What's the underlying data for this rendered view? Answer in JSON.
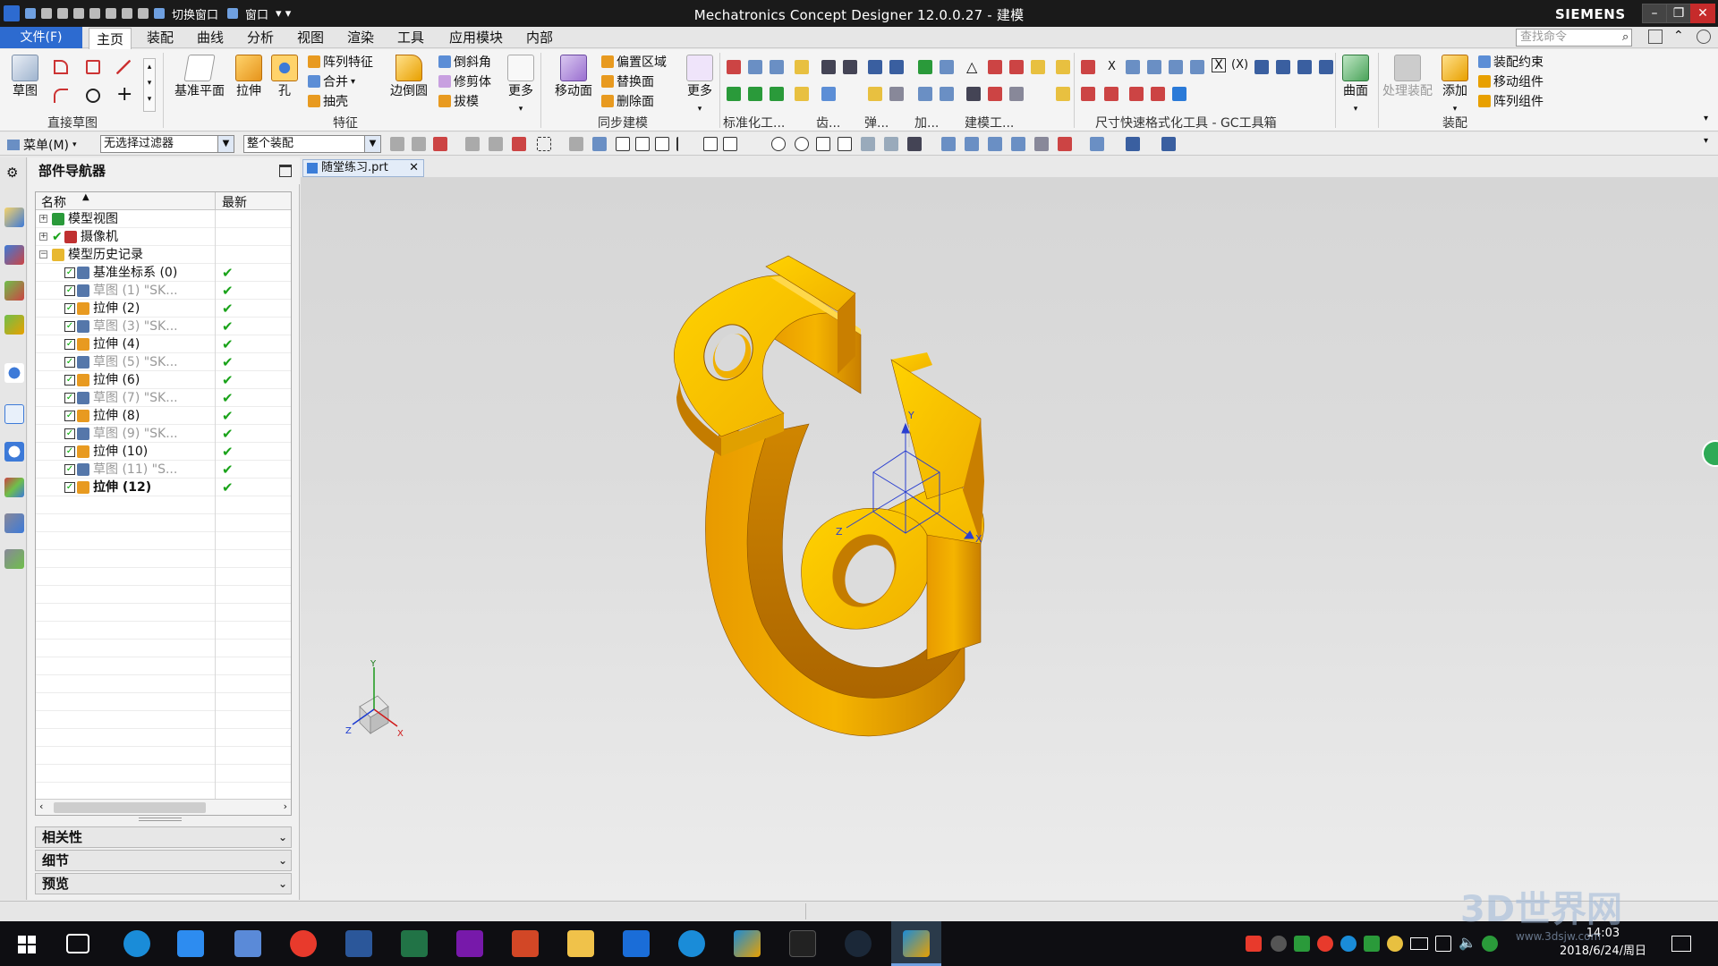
{
  "window": {
    "title": "Mechatronics Concept Designer 12.0.0.27 - 建模",
    "brand": "SIEMENS",
    "quick_access": {
      "switch_window": "切换窗口",
      "window_menu": "窗口"
    }
  },
  "menu": {
    "file": "文件(F)",
    "tabs": [
      "主页",
      "装配",
      "曲线",
      "分析",
      "视图",
      "渲染",
      "工具",
      "应用模块",
      "内部"
    ],
    "search_placeholder": "查找命令"
  },
  "ribbon": {
    "sketch": "草图",
    "direct_sketch_group": "直接草图",
    "datum_plane": "基准平面",
    "extrude": "拉伸",
    "hole": "孔",
    "pattern_feature": "阵列特征",
    "combine": "合并",
    "shell": "抽壳",
    "edge_blend": "边倒圆",
    "chamfer": "倒斜角",
    "trim_body": "修剪体",
    "draft": "拔模",
    "more1": "更多",
    "feature_group": "特征",
    "move_face": "移动面",
    "offset_region": "偏置区域",
    "replace_face": "替换面",
    "delete_face": "删除面",
    "more2": "更多",
    "sync_group": "同步建模",
    "standard_group": "标准化工...",
    "gear_group": "齿...",
    "spring_group": "弹...",
    "add_group": "加...",
    "modeling_tool_group": "建模工...",
    "dimension_group": "尺寸快速格式化工具 - GC工具箱",
    "surface": "曲面",
    "surface_group": "",
    "process_assembly": "处理装配",
    "add": "添加",
    "assembly_constraint": "装配约束",
    "move_component": "移动组件",
    "pattern_component": "阵列组件",
    "assembly_group": "装配"
  },
  "filterbar": {
    "menu": "菜单(M)",
    "filter": "无选择过滤器",
    "scope": "整个装配"
  },
  "navigator": {
    "title": "部件导航器",
    "col_name": "名称",
    "col_latest": "最新",
    "rows": [
      {
        "label": "模型视图",
        "level": 0,
        "expand": "+",
        "icon": "model-views-icon",
        "color": "#2a9a3a",
        "check": false,
        "latest": false,
        "gray": false
      },
      {
        "label": "摄像机",
        "level": 0,
        "expand": "+",
        "icon": "camera-icon",
        "color": "#c03030",
        "check": false,
        "latest": false,
        "gray": false,
        "pretick": true
      },
      {
        "label": "模型历史记录",
        "level": 0,
        "expand": "-",
        "icon": "folder-icon",
        "color": "#e8b830",
        "check": false,
        "latest": false,
        "gray": false
      },
      {
        "label": "基准坐标系 (0)",
        "level": 1,
        "icon": "datum-csys-icon",
        "color": "#5577aa",
        "check": true,
        "latest": true,
        "gray": false
      },
      {
        "label": "草图 (1) \"SK...",
        "level": 1,
        "icon": "sketch-icon",
        "color": "#5577aa",
        "check": true,
        "latest": true,
        "gray": true
      },
      {
        "label": "拉伸 (2)",
        "level": 1,
        "icon": "extrude-icon",
        "color": "#e89a20",
        "check": true,
        "latest": true,
        "gray": false
      },
      {
        "label": "草图 (3) \"SK...",
        "level": 1,
        "icon": "sketch-icon",
        "color": "#5577aa",
        "check": true,
        "latest": true,
        "gray": true
      },
      {
        "label": "拉伸 (4)",
        "level": 1,
        "icon": "extrude-icon",
        "color": "#e89a20",
        "check": true,
        "latest": true,
        "gray": false
      },
      {
        "label": "草图 (5) \"SK...",
        "level": 1,
        "icon": "sketch-icon",
        "color": "#5577aa",
        "check": true,
        "latest": true,
        "gray": true
      },
      {
        "label": "拉伸 (6)",
        "level": 1,
        "icon": "extrude-icon",
        "color": "#e89a20",
        "check": true,
        "latest": true,
        "gray": false
      },
      {
        "label": "草图 (7) \"SK...",
        "level": 1,
        "icon": "sketch-icon",
        "color": "#5577aa",
        "check": true,
        "latest": true,
        "gray": true
      },
      {
        "label": "拉伸 (8)",
        "level": 1,
        "icon": "extrude-icon",
        "color": "#e89a20",
        "check": true,
        "latest": true,
        "gray": false
      },
      {
        "label": "草图 (9) \"SK...",
        "level": 1,
        "icon": "sketch-icon",
        "color": "#5577aa",
        "check": true,
        "latest": true,
        "gray": true
      },
      {
        "label": "拉伸 (10)",
        "level": 1,
        "icon": "extrude-icon",
        "color": "#e89a20",
        "check": true,
        "latest": true,
        "gray": false
      },
      {
        "label": "草图 (11) \"S...",
        "level": 1,
        "icon": "sketch-icon",
        "color": "#5577aa",
        "check": true,
        "latest": true,
        "gray": true
      },
      {
        "label": "拉伸 (12)",
        "level": 1,
        "icon": "extrude-icon",
        "color": "#e89a20",
        "check": true,
        "latest": true,
        "gray": false,
        "bold": true
      }
    ],
    "panels": [
      "相关性",
      "细节",
      "预览"
    ]
  },
  "document": {
    "tab": "随堂练习.prt"
  },
  "viewport": {
    "part_color": "#e8a000",
    "csys_labels": {
      "x": "X",
      "y": "Y",
      "z": "Z"
    },
    "triad_labels": {
      "x": "X",
      "y": "Y",
      "z": "Z"
    }
  },
  "taskbar": {
    "time": "14:03",
    "date": "2018/6/24/周日"
  },
  "watermark": {
    "text": "3D世界网",
    "url": "www.3dsjw.com"
  }
}
